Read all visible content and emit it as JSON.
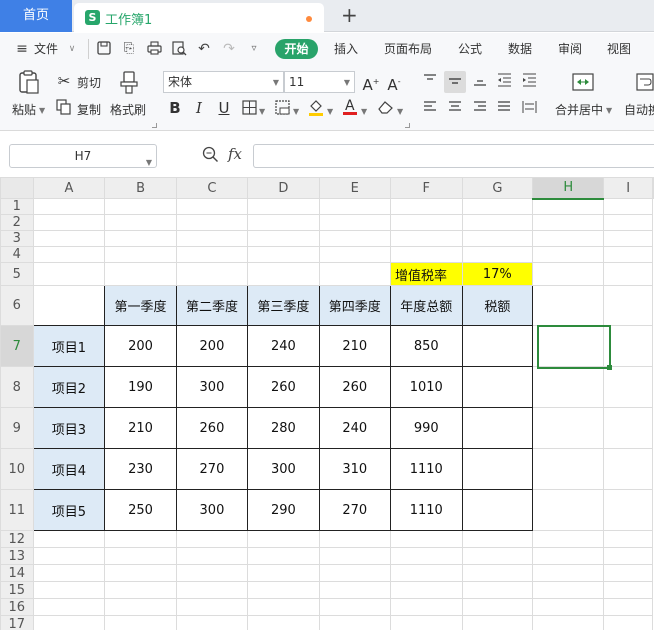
{
  "tabs": {
    "home": "首页",
    "doc_icon": "S",
    "doc_title": "工作簿1",
    "new_tab": "+"
  },
  "menu": {
    "file": "文件",
    "start": "开始",
    "insert": "插入",
    "layout": "页面布局",
    "formula": "公式",
    "data": "数据",
    "review": "审阅",
    "view": "视图"
  },
  "ribbon": {
    "paste": "粘贴",
    "cut": "剪切",
    "copy": "复制",
    "format_painter": "格式刷",
    "font_name": "宋体",
    "font_size": "11",
    "merge_center": "合并居中",
    "auto_wrap": "自动换"
  },
  "formula_bar": {
    "cell_ref": "H7",
    "fx": "fx",
    "value": ""
  },
  "columns": [
    "A",
    "B",
    "C",
    "D",
    "E",
    "F",
    "G",
    "H",
    "I"
  ],
  "selected_column": "H",
  "selected_row": "7",
  "rows": [
    "1",
    "2",
    "3",
    "4",
    "5",
    "6",
    "7",
    "8",
    "9",
    "10",
    "11",
    "12",
    "13",
    "14",
    "15",
    "16",
    "17"
  ],
  "tax": {
    "label": "增值税率",
    "rate": "17%"
  },
  "table": {
    "headers": [
      "",
      "第一季度",
      "第二季度",
      "第三季度",
      "第四季度",
      "年度总额",
      "税额"
    ],
    "rows": [
      [
        "项目1",
        "200",
        "200",
        "240",
        "210",
        "850",
        ""
      ],
      [
        "项目2",
        "190",
        "300",
        "260",
        "260",
        "1010",
        ""
      ],
      [
        "项目3",
        "210",
        "260",
        "280",
        "240",
        "990",
        ""
      ],
      [
        "项目4",
        "230",
        "270",
        "300",
        "310",
        "1110",
        ""
      ],
      [
        "项目5",
        "250",
        "300",
        "290",
        "270",
        "1110",
        ""
      ]
    ]
  },
  "colors": {
    "accent": "#3f80e6",
    "start_tab": "#29a36a",
    "selection": "#2d8b3c",
    "tax_fill": "#ffff00",
    "label_fill": "#ddeaf6"
  }
}
